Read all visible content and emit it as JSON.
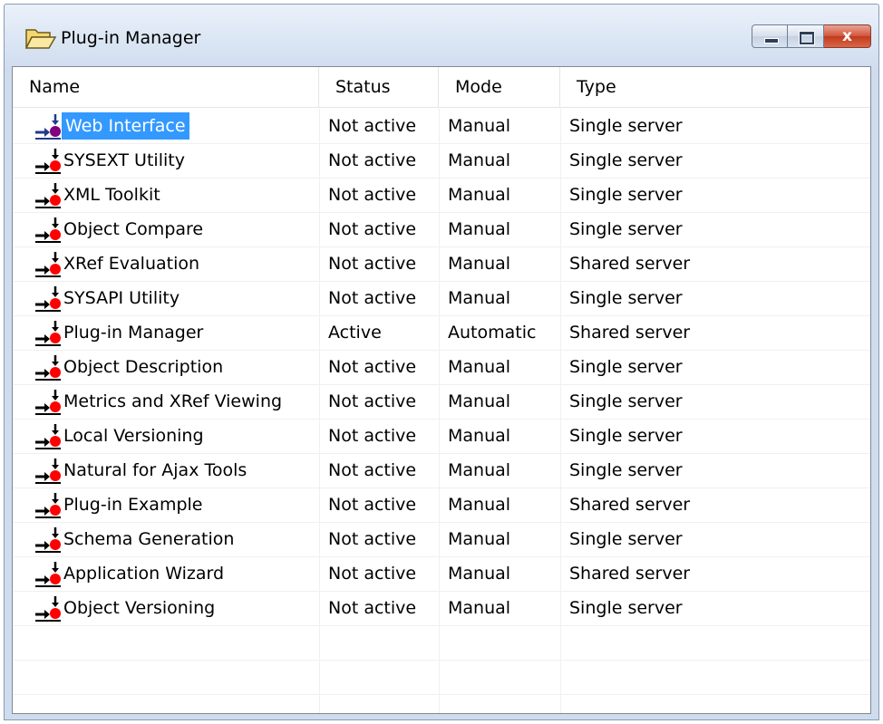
{
  "window": {
    "title": "Plug-in Manager",
    "title_icon": "open-folder-icon",
    "buttons": {
      "minimize": "minimize-icon",
      "maximize": "maximize-icon",
      "close": "close-icon",
      "close_glyph": "x"
    }
  },
  "columns": [
    "Name",
    "Status",
    "Mode",
    "Type"
  ],
  "rows": [
    {
      "name": "Web Interface",
      "status": "Not active",
      "mode": "Manual",
      "type": "Single server",
      "selected": true
    },
    {
      "name": "SYSEXT Utility",
      "status": "Not active",
      "mode": "Manual",
      "type": "Single server"
    },
    {
      "name": "XML Toolkit",
      "status": "Not active",
      "mode": "Manual",
      "type": "Single server"
    },
    {
      "name": "Object Compare",
      "status": "Not active",
      "mode": "Manual",
      "type": "Single server"
    },
    {
      "name": "XRef Evaluation",
      "status": "Not active",
      "mode": "Manual",
      "type": "Shared server"
    },
    {
      "name": "SYSAPI Utility",
      "status": "Not active",
      "mode": "Manual",
      "type": "Single server"
    },
    {
      "name": "Plug-in Manager",
      "status": "Active",
      "mode": "Automatic",
      "type": "Shared server"
    },
    {
      "name": "Object Description",
      "status": "Not active",
      "mode": "Manual",
      "type": "Single server"
    },
    {
      "name": "Metrics and XRef Viewing",
      "status": "Not active",
      "mode": "Manual",
      "type": "Single server"
    },
    {
      "name": "Local Versioning",
      "status": "Not active",
      "mode": "Manual",
      "type": "Single server"
    },
    {
      "name": "Natural for Ajax Tools",
      "status": "Not active",
      "mode": "Manual",
      "type": "Single server"
    },
    {
      "name": "Plug-in Example",
      "status": "Not active",
      "mode": "Manual",
      "type": "Shared server"
    },
    {
      "name": "Schema Generation",
      "status": "Not active",
      "mode": "Manual",
      "type": "Single server"
    },
    {
      "name": "Application Wizard",
      "status": "Not active",
      "mode": "Manual",
      "type": "Shared server"
    },
    {
      "name": "Object Versioning",
      "status": "Not active",
      "mode": "Manual",
      "type": "Single server"
    }
  ],
  "row_icon": "plugin-inactive-icon",
  "colors": {
    "selection": "#3399ff",
    "icon_arrow": "#000000",
    "icon_dot": "#ff0000",
    "icon_dot_selected": "#800080"
  }
}
